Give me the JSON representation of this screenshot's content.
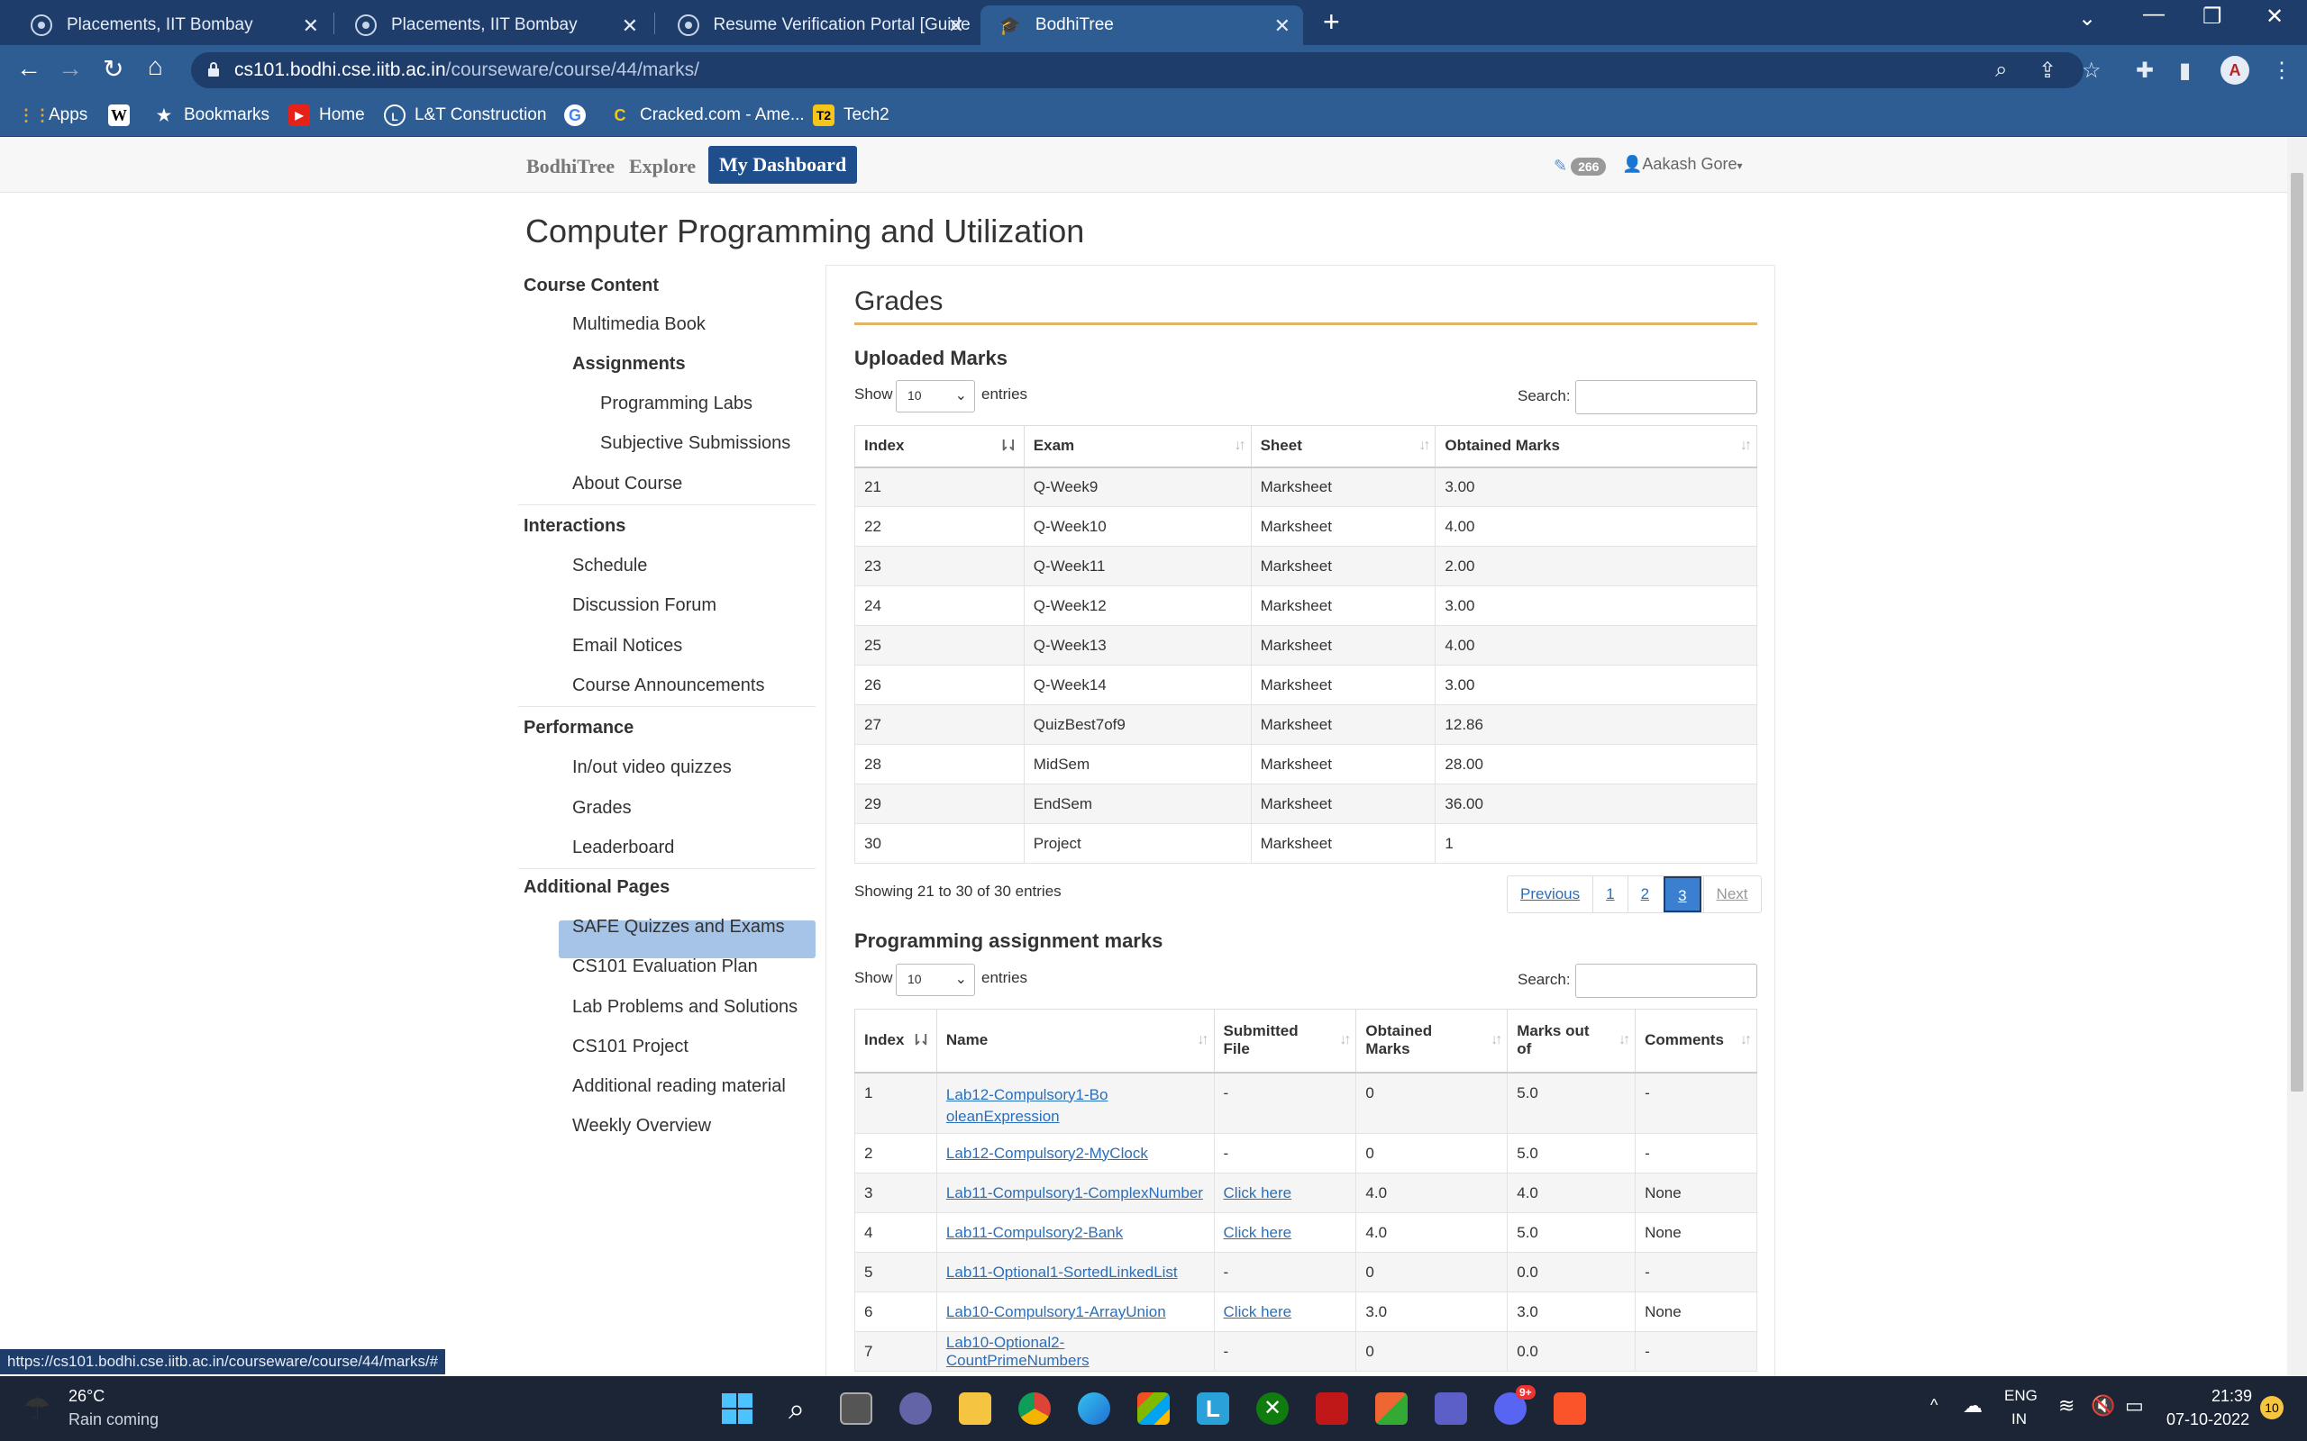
{
  "browser": {
    "tabs": [
      {
        "title": "Placements, IIT Bombay",
        "active": false
      },
      {
        "title": "Placements, IIT Bombay",
        "active": false
      },
      {
        "title": "Resume Verification Portal [Guide",
        "active": false
      },
      {
        "title": "BodhiTree",
        "active": true
      }
    ],
    "url_host": "cs101.bodhi.cse.iitb.ac.in",
    "url_path": "/courseware/course/44/marks/",
    "bookmarks": [
      "Apps",
      "Bookmarks",
      "Home",
      "L&T Construction",
      "Cracked.com - Ame...",
      "Tech2"
    ],
    "status_url": "https://cs101.bodhi.cse.iitb.ac.in/courseware/course/44/marks/#"
  },
  "topnav": {
    "brand": "BodhiTree",
    "explore": "Explore",
    "dashboard": "My Dashboard",
    "points": "266",
    "user": "Aakash Gore"
  },
  "course_title": "Computer Programming and Utilization",
  "sidebar": {
    "course_content": "Course Content",
    "multimedia_book": "Multimedia Book",
    "assignments": "Assignments",
    "programming_labs": "Programming Labs",
    "subjective_submissions": "Subjective Submissions",
    "about_course": "About Course",
    "interactions": "Interactions",
    "schedule": "Schedule",
    "discussion_forum": "Discussion Forum",
    "email_notices": "Email Notices",
    "course_announcements": "Course Announcements",
    "performance": "Performance",
    "inout_video_quizzes": "In/out video quizzes",
    "grades": "Grades",
    "leaderboard": "Leaderboard",
    "additional_pages": "Additional Pages",
    "safe_quizzes": "SAFE Quizzes and Exams",
    "evaluation_plan": "CS101 Evaluation Plan",
    "lab_problems": "Lab Problems and Solutions",
    "cs101_project": "CS101 Project",
    "additional_reading": "Additional reading material",
    "weekly_overview": "Weekly Overview"
  },
  "main": {
    "title": "Grades",
    "uploaded": {
      "heading": "Uploaded Marks",
      "show": "Show",
      "entries": "entries",
      "page_size": "10",
      "search_label": "Search:",
      "columns": [
        "Index",
        "Exam",
        "Sheet",
        "Obtained Marks"
      ],
      "rows": [
        [
          "21",
          "Q-Week9",
          "Marksheet",
          "3.00"
        ],
        [
          "22",
          "Q-Week10",
          "Marksheet",
          "4.00"
        ],
        [
          "23",
          "Q-Week11",
          "Marksheet",
          "2.00"
        ],
        [
          "24",
          "Q-Week12",
          "Marksheet",
          "3.00"
        ],
        [
          "25",
          "Q-Week13",
          "Marksheet",
          "4.00"
        ],
        [
          "26",
          "Q-Week14",
          "Marksheet",
          "3.00"
        ],
        [
          "27",
          "QuizBest7of9",
          "Marksheet",
          "12.86"
        ],
        [
          "28",
          "MidSem",
          "Marksheet",
          "28.00"
        ],
        [
          "29",
          "EndSem",
          "Marksheet",
          "36.00"
        ],
        [
          "30",
          "Project",
          "Marksheet",
          "1"
        ]
      ],
      "info": "Showing 21 to 30 of 30 entries",
      "pager": {
        "previous": "Previous",
        "p1": "1",
        "p2": "2",
        "p3": "3",
        "next": "Next"
      }
    },
    "programming": {
      "heading": "Programming assignment marks",
      "show": "Show",
      "entries": "entries",
      "page_size": "10",
      "search_label": "Search:",
      "columns": [
        "Index",
        "Name",
        "Submitted File",
        "Obtained Marks",
        "Marks out of",
        "Comments"
      ],
      "rows": [
        [
          "1",
          "Lab12-Compulsory1-BooleanExpression",
          "-",
          "0",
          "5.0",
          "-"
        ],
        [
          "2",
          "Lab12-Compulsory2-MyClock",
          "-",
          "0",
          "5.0",
          "-"
        ],
        [
          "3",
          "Lab11-Compulsory1-ComplexNumber",
          "Click here",
          "4.0",
          "4.0",
          "None"
        ],
        [
          "4",
          "Lab11-Compulsory2-Bank",
          "Click here",
          "4.0",
          "5.0",
          "None"
        ],
        [
          "5",
          "Lab11-Optional1-SortedLinkedList",
          "-",
          "0",
          "0.0",
          "-"
        ],
        [
          "6",
          "Lab10-Compulsory1-ArrayUnion",
          "Click here",
          "3.0",
          "3.0",
          "None"
        ],
        [
          "7",
          "Lab10-Optional2-CountPrimeNumbers",
          "-",
          "0",
          "0.0",
          "-"
        ]
      ]
    }
  },
  "taskbar": {
    "weather_temp": "26°C",
    "weather_desc": "Rain coming",
    "lang1": "ENG",
    "lang2": "IN",
    "time": "21:39",
    "date": "07-10-2022",
    "notifications": "10",
    "discord_badge": "9+"
  },
  "colors": {
    "accent": "#1e4e8c",
    "highlight": "#a6c3e8",
    "rule": "#e0b56a",
    "link": "#2a6fbb"
  }
}
